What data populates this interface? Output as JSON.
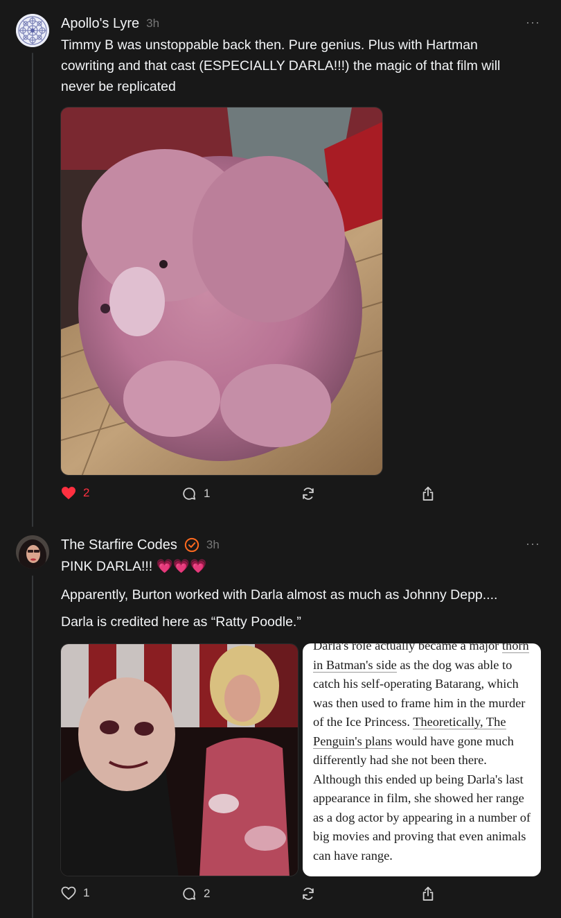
{
  "post1": {
    "username": "Apollo's Lyre",
    "time": "3h",
    "more": "···",
    "text": "Timmy B was unstoppable back then. Pure genius. Plus with Hartman cowriting and that cast (ESPECIALLY DARLA!!!) the magic of that film will never be replicated",
    "image_alt": "pink poodle",
    "likes": "2",
    "comments": "1",
    "liked": true
  },
  "post2": {
    "username": "The Starfire Codes",
    "time": "3h",
    "more": "···",
    "line1": "PINK DARLA!!! 💗💗💗",
    "line2": "Apparently, Burton worked with Darla almost as much as Johnny Depp....",
    "line3": "Darla is credited here as “Ratty Poodle.”",
    "quote": {
      "p1": "Darla's role actually became a major",
      "u1": "thorn in Batman's side",
      "p2": " as the dog was able to catch his self-operating Batarang, which was then used to frame him in the murder of the Ice Princess.",
      "u2": "Theoretically, The Penguin's plans",
      "p3": " would have gone much differently had she not been there. Although this ended up being Darla's last appearance in film, she showed her range as a dog actor by appearing in a number of big movies and proving that even animals can have range."
    },
    "likes": "1",
    "comments": "2"
  },
  "colors": {
    "like_red": "#ff3040",
    "verified_orange": "#ff6a1f",
    "background": "#181818"
  },
  "icons": [
    "heart-icon",
    "comment-icon",
    "repost-icon",
    "share-icon",
    "verified-badge-icon",
    "more-icon"
  ]
}
